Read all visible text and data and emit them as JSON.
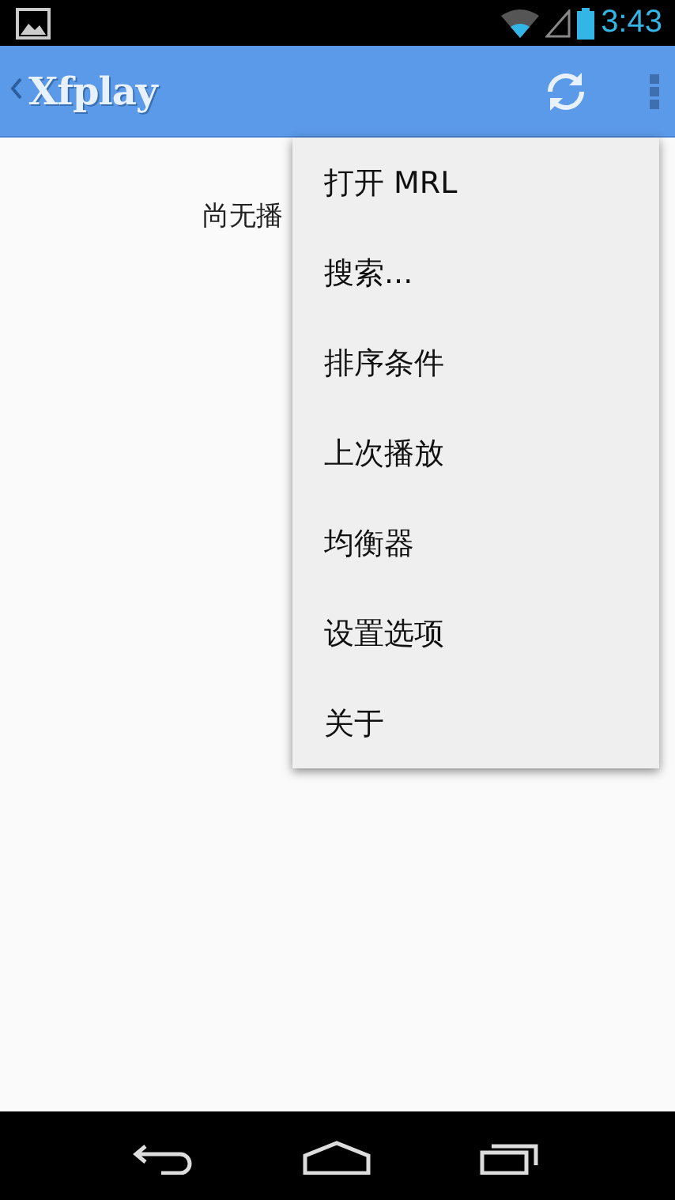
{
  "status_bar": {
    "time": "3:43"
  },
  "app_bar": {
    "title": "Xfplay"
  },
  "content": {
    "empty_message": "尚无播"
  },
  "menu": {
    "items": [
      {
        "label": "打开 MRL"
      },
      {
        "label": "搜索..."
      },
      {
        "label": "排序条件"
      },
      {
        "label": "上次播放"
      },
      {
        "label": "均衡器"
      },
      {
        "label": "设置选项"
      },
      {
        "label": "关于"
      }
    ]
  }
}
